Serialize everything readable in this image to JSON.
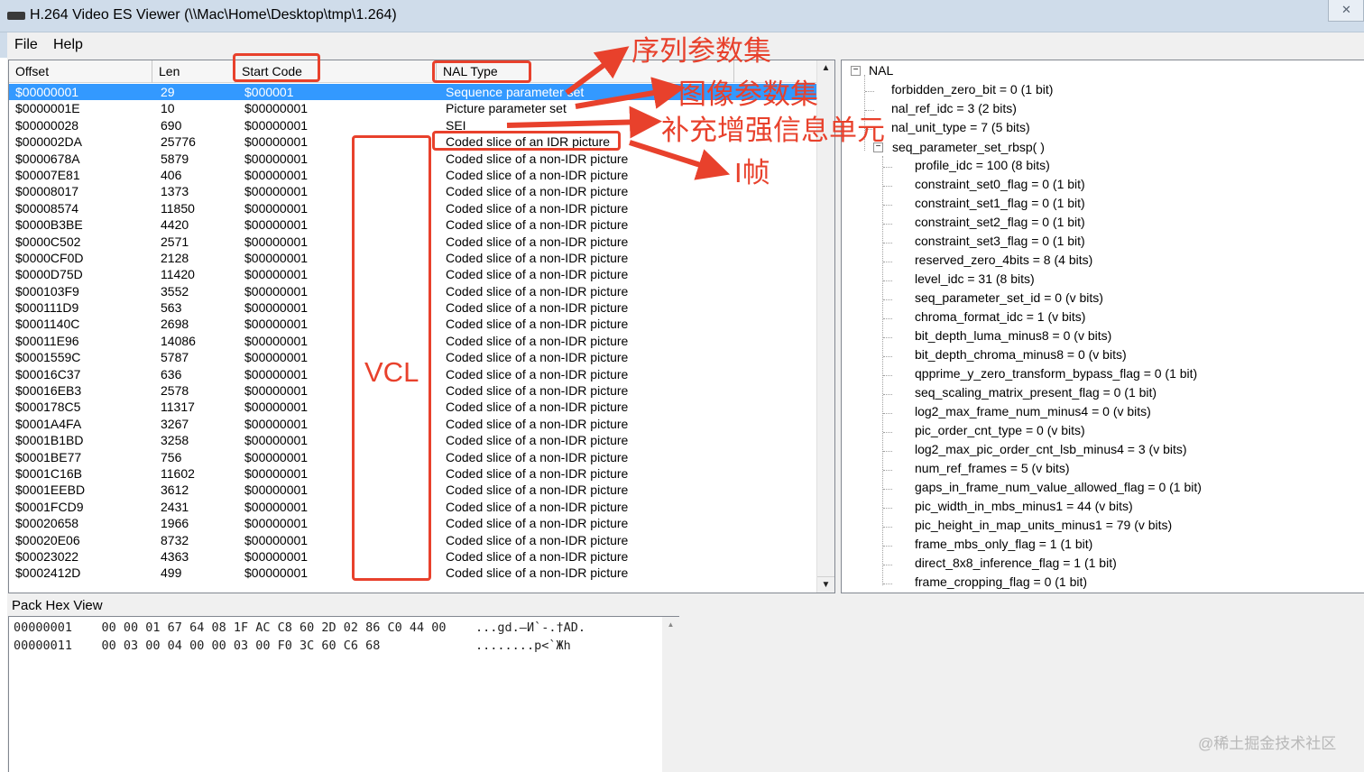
{
  "window": {
    "title": "H.264 Video ES Viewer (\\\\Mac\\Home\\Desktop\\tmp\\1.264)",
    "close_glyph": "✕"
  },
  "menu": {
    "file": "File",
    "help": "Help"
  },
  "list": {
    "columns": [
      "Offset",
      "Len",
      "Start Code",
      "NAL Type"
    ],
    "selected_row": 0,
    "rows": [
      [
        "$00000001",
        "29",
        "$000001",
        "Sequence parameter set"
      ],
      [
        "$0000001E",
        "10",
        "$00000001",
        "Picture parameter set"
      ],
      [
        "$00000028",
        "690",
        "$00000001",
        "SEI"
      ],
      [
        "$000002DA",
        "25776",
        "$00000001",
        "Coded slice of an IDR picture"
      ],
      [
        "$0000678A",
        "5879",
        "$00000001",
        "Coded slice of a non-IDR picture"
      ],
      [
        "$00007E81",
        "406",
        "$00000001",
        "Coded slice of a non-IDR picture"
      ],
      [
        "$00008017",
        "1373",
        "$00000001",
        "Coded slice of a non-IDR picture"
      ],
      [
        "$00008574",
        "11850",
        "$00000001",
        "Coded slice of a non-IDR picture"
      ],
      [
        "$0000B3BE",
        "4420",
        "$00000001",
        "Coded slice of a non-IDR picture"
      ],
      [
        "$0000C502",
        "2571",
        "$00000001",
        "Coded slice of a non-IDR picture"
      ],
      [
        "$0000CF0D",
        "2128",
        "$00000001",
        "Coded slice of a non-IDR picture"
      ],
      [
        "$0000D75D",
        "11420",
        "$00000001",
        "Coded slice of a non-IDR picture"
      ],
      [
        "$000103F9",
        "3552",
        "$00000001",
        "Coded slice of a non-IDR picture"
      ],
      [
        "$000111D9",
        "563",
        "$00000001",
        "Coded slice of a non-IDR picture"
      ],
      [
        "$0001140C",
        "2698",
        "$00000001",
        "Coded slice of a non-IDR picture"
      ],
      [
        "$00011E96",
        "14086",
        "$00000001",
        "Coded slice of a non-IDR picture"
      ],
      [
        "$0001559C",
        "5787",
        "$00000001",
        "Coded slice of a non-IDR picture"
      ],
      [
        "$00016C37",
        "636",
        "$00000001",
        "Coded slice of a non-IDR picture"
      ],
      [
        "$00016EB3",
        "2578",
        "$00000001",
        "Coded slice of a non-IDR picture"
      ],
      [
        "$000178C5",
        "11317",
        "$00000001",
        "Coded slice of a non-IDR picture"
      ],
      [
        "$0001A4FA",
        "3267",
        "$00000001",
        "Coded slice of a non-IDR picture"
      ],
      [
        "$0001B1BD",
        "3258",
        "$00000001",
        "Coded slice of a non-IDR picture"
      ],
      [
        "$0001BE77",
        "756",
        "$00000001",
        "Coded slice of a non-IDR picture"
      ],
      [
        "$0001C16B",
        "11602",
        "$00000001",
        "Coded slice of a non-IDR picture"
      ],
      [
        "$0001EEBD",
        "3612",
        "$00000001",
        "Coded slice of a non-IDR picture"
      ],
      [
        "$0001FCD9",
        "2431",
        "$00000001",
        "Coded slice of a non-IDR picture"
      ],
      [
        "$00020658",
        "1966",
        "$00000001",
        "Coded slice of a non-IDR picture"
      ],
      [
        "$00020E06",
        "8732",
        "$00000001",
        "Coded slice of a non-IDR picture"
      ],
      [
        "$00023022",
        "4363",
        "$00000001",
        "Coded slice of a non-IDR picture"
      ],
      [
        "$0002412D",
        "499",
        "$00000001",
        "Coded slice of a non-IDR picture"
      ]
    ]
  },
  "tree": {
    "root": "NAL",
    "root_fields": [
      "forbidden_zero_bit = 0 (1 bit)",
      "nal_ref_idc = 3 (2 bits)",
      "nal_unit_type = 7 (5 bits)"
    ],
    "sps_node": "seq_parameter_set_rbsp( )",
    "sps_fields": [
      "profile_idc = 100 (8 bits)",
      "constraint_set0_flag = 0 (1 bit)",
      "constraint_set1_flag = 0 (1 bit)",
      "constraint_set2_flag = 0 (1 bit)",
      "constraint_set3_flag = 0 (1 bit)",
      "reserved_zero_4bits = 8 (4 bits)",
      "level_idc = 31 (8 bits)",
      "seq_parameter_set_id = 0 (v bits)",
      "chroma_format_idc = 1 (v bits)",
      "bit_depth_luma_minus8 = 0 (v bits)",
      "bit_depth_chroma_minus8 = 0 (v bits)",
      "qpprime_y_zero_transform_bypass_flag = 0 (1 bit)",
      "seq_scaling_matrix_present_flag = 0 (1 bit)",
      "log2_max_frame_num_minus4 = 0 (v bits)",
      "pic_order_cnt_type = 0 (v bits)",
      "log2_max_pic_order_cnt_lsb_minus4 = 3 (v bits)",
      "num_ref_frames = 5 (v bits)",
      "gaps_in_frame_num_value_allowed_flag = 0 (1 bit)",
      "pic_width_in_mbs_minus1 = 44 (v bits)",
      "pic_height_in_map_units_minus1 = 79 (v bits)",
      "frame_mbs_only_flag = 1 (1 bit)",
      "direct_8x8_inference_flag = 1 (1 bit)",
      "frame_cropping_flag = 0 (1 bit)"
    ],
    "expander_glyph": "−"
  },
  "hex": {
    "label": "Pack Hex View",
    "lines": [
      "00000001    00 00 01 67 64 08 1F AC C8 60 2D 02 86 C0 44 00    ...gd.–И`-.†AD.",
      "00000011    00 03 00 04 00 00 03 00 F0 3C 60 C6 68             ........p<`Жh"
    ]
  },
  "annotations": {
    "sps": "序列参数集",
    "pps": "图像参数集",
    "sei": "补充增强信息单元",
    "iframe": "I帧",
    "vcl": "VCL",
    "color": "#e8412c"
  },
  "scroll": {
    "up": "▲",
    "down": "▼"
  },
  "watermark": "@稀土掘金技术社区"
}
